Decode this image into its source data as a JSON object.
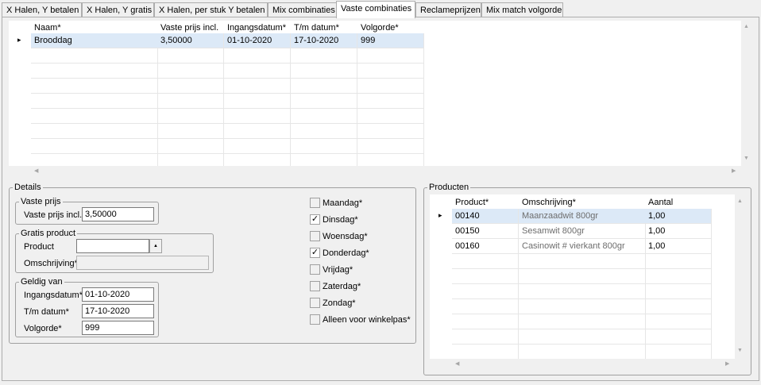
{
  "tabs": [
    {
      "label": "X Halen, Y betalen"
    },
    {
      "label": "X Halen, Y gratis"
    },
    {
      "label": "X Halen, per stuk Y betalen"
    },
    {
      "label": "Mix combinaties"
    },
    {
      "label": "Vaste combinaties"
    },
    {
      "label": "Reclameprijzen"
    },
    {
      "label": "Mix match volgorde"
    }
  ],
  "main_grid": {
    "columns": [
      "Naam*",
      "Vaste prijs incl.",
      "Ingangsdatum*",
      "T/m datum*",
      "Volgorde*"
    ],
    "rows": [
      [
        "Brooddag",
        "3,50000",
        "01-10-2020",
        "17-10-2020",
        "999"
      ]
    ],
    "row_indicator": "▸"
  },
  "details": {
    "title": "Details",
    "vaste_prijs": {
      "title": "Vaste prijs",
      "label": "Vaste prijs incl.",
      "value": "3,50000"
    },
    "gratis_product": {
      "title": "Gratis product",
      "product_label": "Product",
      "product_value": "",
      "omschrijving_label": "Omschrijving*",
      "omschrijving_value": ""
    },
    "geldig_van": {
      "title": "Geldig van",
      "ingangsdatum_label": "Ingangsdatum*",
      "ingangsdatum_value": "01-10-2020",
      "tm_label": "T/m datum*",
      "tm_value": "17-10-2020",
      "volgorde_label": "Volgorde*",
      "volgorde_value": "999"
    },
    "days": [
      {
        "label": "Maandag*",
        "checked": false
      },
      {
        "label": "Dinsdag*",
        "checked": true
      },
      {
        "label": "Woensdag*",
        "checked": false
      },
      {
        "label": "Donderdag*",
        "checked": true
      },
      {
        "label": "Vrijdag*",
        "checked": false
      },
      {
        "label": "Zaterdag*",
        "checked": false
      },
      {
        "label": "Zondag*",
        "checked": false
      },
      {
        "label": "Alleen voor winkelpas*",
        "checked": false
      }
    ],
    "check_mark": "✓"
  },
  "producten": {
    "title": "Producten",
    "columns": [
      "Product*",
      "Omschrijving*",
      "Aantal"
    ],
    "rows": [
      [
        "00140",
        "Maanzaadwit 800gr",
        "1,00"
      ],
      [
        "00150",
        "Sesamwit 800gr",
        "1,00"
      ],
      [
        "00160",
        "Casinowit # vierkant 800gr",
        "1,00"
      ]
    ],
    "row_indicator": "▸"
  },
  "scroll_arrows": {
    "up": "▲",
    "down": "▼",
    "left": "◀",
    "right": "▶"
  },
  "dropdown_arrow": "▲"
}
